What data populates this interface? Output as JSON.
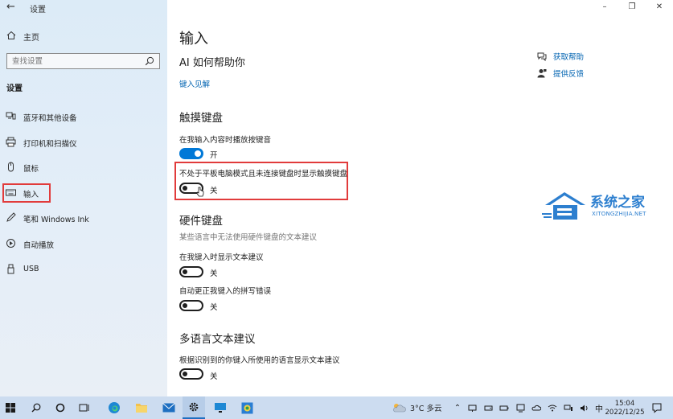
{
  "window": {
    "title": "设置",
    "minimize_glyph": "–",
    "maximize_glyph": "❐",
    "close_glyph": "✕"
  },
  "sidebar": {
    "home_label": "主页",
    "search_placeholder": "查找设置",
    "section_title": "设置",
    "items": [
      {
        "label": "蓝牙和其他设备",
        "icon": "bluetooth-icon"
      },
      {
        "label": "打印机和扫描仪",
        "icon": "printer-icon"
      },
      {
        "label": "鼠标",
        "icon": "mouse-icon"
      },
      {
        "label": "输入",
        "icon": "keyboard-icon",
        "active": true
      },
      {
        "label": "笔和 Windows Ink",
        "icon": "pen-icon"
      },
      {
        "label": "自动播放",
        "icon": "autoplay-icon"
      },
      {
        "label": "USB",
        "icon": "usb-icon"
      }
    ]
  },
  "main": {
    "page_title": "输入",
    "ai_title": "AI 如何帮助你",
    "ai_link": "键入见解",
    "help_links": [
      {
        "label": "获取帮助",
        "icon": "help-chat-icon"
      },
      {
        "label": "提供反馈",
        "icon": "feedback-icon"
      }
    ],
    "touch_keyboard": {
      "title": "触摸键盘",
      "settings": [
        {
          "label": "在我输入内容时播放按键音",
          "state": "开",
          "on": true
        },
        {
          "label": "不处于平板电脑模式且未连接键盘时显示触摸键盘",
          "state": "关",
          "on": false
        }
      ]
    },
    "hardware_keyboard": {
      "title": "硬件键盘",
      "note": "某些语言中无法使用硬件键盘的文本建议",
      "settings": [
        {
          "label": "在我键入时显示文本建议",
          "state": "关",
          "on": false
        },
        {
          "label": "自动更正我键入的拼写错误",
          "state": "关",
          "on": false
        }
      ]
    },
    "multilingual": {
      "title": "多语言文本建议",
      "settings": [
        {
          "label": "根据识别到的你键入所使用的语言显示文本建议",
          "state": "关",
          "on": false
        }
      ]
    }
  },
  "watermark": {
    "name": "系统之家",
    "url": "XITONGZHIJIA.NET"
  },
  "taskbar": {
    "weather": "3°C 多云",
    "ime": "中",
    "time": "15:04",
    "date": "2022/12/25"
  },
  "colors": {
    "accent": "#0078d7",
    "link": "#0063b1",
    "highlight": "#e13b3b",
    "sidebar_bg": "#dcebf7",
    "taskbar_bg": "#ccdcf0"
  }
}
